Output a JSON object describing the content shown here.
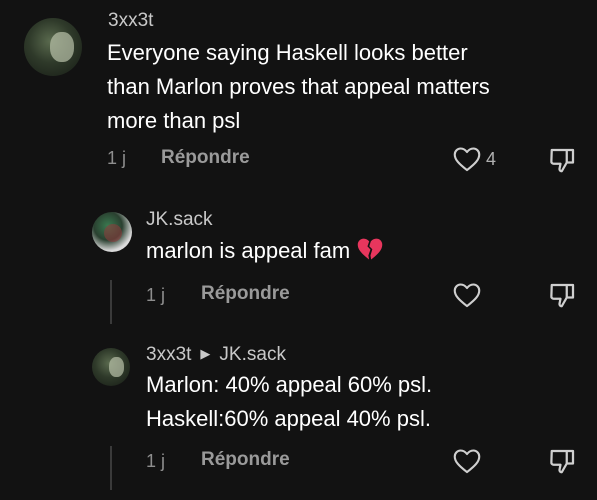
{
  "comment_main": {
    "username": "3xx3t",
    "text_line1": "Everyone saying Haskell looks better",
    "text_line2": "than Marlon proves that appeal matters",
    "text_line3": "more than psl",
    "time": "1 j",
    "reply_label": "Répondre",
    "like_count": "4"
  },
  "reply_jk": {
    "username": "JK.sack",
    "text": "marlon is appeal fam",
    "emoji": "broken-heart",
    "time": "1 j",
    "reply_label": "Répondre"
  },
  "reply_3xx3t": {
    "username": "3xx3t",
    "reply_to": "JK.sack",
    "text_line1": "Marlon: 40% appeal 60% psl.",
    "text_line2": "Haskell:60% appeal 40% psl.",
    "time": "1 j",
    "reply_label": "Répondre"
  },
  "colors": {
    "background": "#121212",
    "text": "#ffffff",
    "muted": "#8e8e8e",
    "broken_heart": "#e8365d"
  }
}
